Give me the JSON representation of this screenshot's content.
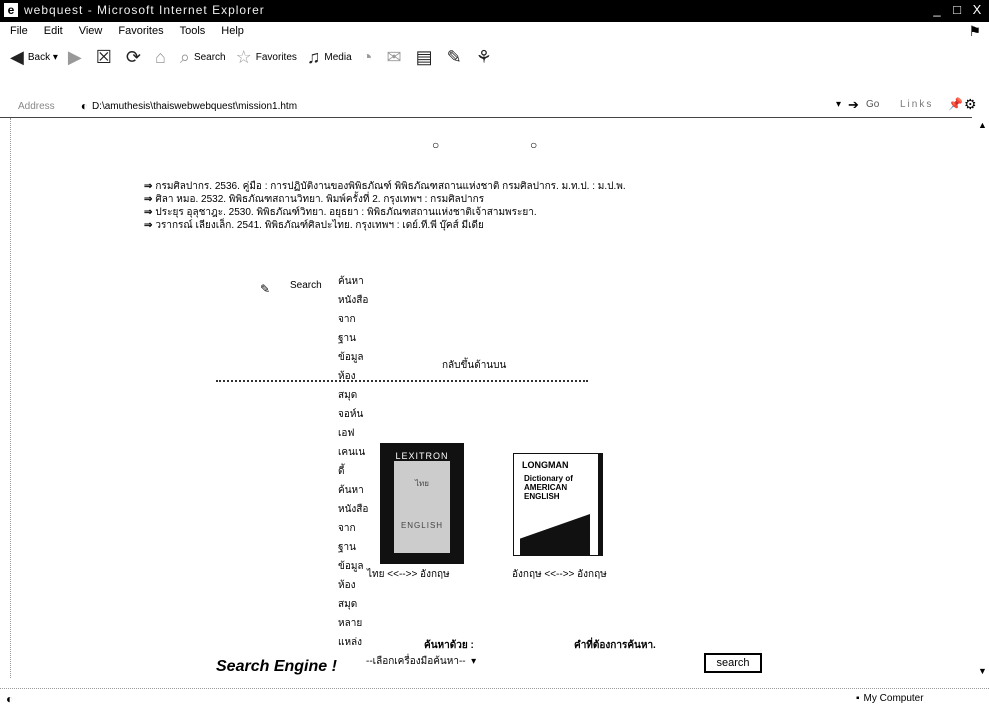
{
  "window": {
    "title": "webquest - Microsoft Internet Explorer",
    "minimize": "_",
    "maximize": "□",
    "close": "X"
  },
  "menu": [
    "File",
    "Edit",
    "View",
    "Favorites",
    "Tools",
    "Help"
  ],
  "toolbar": {
    "back": "Back",
    "search": "Search",
    "favorites": "Favorites",
    "media": "Media"
  },
  "address": {
    "label": "Address",
    "url": "D:\\amuthesis\\thaiswebwebquest\\mission1.htm",
    "go": "Go",
    "links": "Links"
  },
  "refs": [
    "กรมศิลปากร. 2536. คู่มือ : การปฏิบัติงานของพิพิธภัณฑ์ พิพิธภัณฑสถานแห่งชาติ กรมศิลปากร. ม.ท.ป. : ม.ป.พ.",
    "ศิลา หมอ. 2532. พิพิธภัณฑสถานวิทยา. พิมพ์ครั้งที่ 2. กรุงเทพฯ : กรมศิลปากร",
    "ประยุร อุลุชาฎะ. 2530. พิพิธภัณฑ์วิทยา. อยุธยา : พิพิธภัณฑสถานแห่งชาติเจ้าสามพระยา.",
    "วรากรณ์ เลียงเล็ก. 2541. พิพิธภัณฑ์ศิลปะไทย. กรุงเทพฯ : เดย์.ที.พี บุ๊คส์ มีเดีย"
  ],
  "search_links": {
    "label": "Search",
    "items": [
      "ค้นหาหนังสือจากฐานข้อมูลห้องสมุดจอห์น เอฟ เคนเนดี้",
      "ค้นหาหนังสือจากฐานข้อมูลห้องสมุดหลายแหล่ง"
    ]
  },
  "back_to_top": "กลับขึ้นด้านบน",
  "dictionaries": [
    {
      "cover_head": "LEXITRON",
      "cover_mid": "ไทย",
      "cover_low": "ENGLISH",
      "caption": "ไทย <<-->> อังกฤษ"
    },
    {
      "cover_brand": "LONGMAN",
      "cover_title": "Dictionary of AMERICAN ENGLISH",
      "caption": "อังกฤษ <<-->> อังกฤษ"
    }
  ],
  "search_engine": {
    "label": "Search Engine !",
    "find_by": "ค้นหาด้วย :",
    "find_for": "คำที่ต้องการค้นหา.",
    "select_value": "--เลือกเครื่องมือค้นหา--",
    "term_value": "",
    "button": "search"
  },
  "status": {
    "zone": "My Computer"
  }
}
